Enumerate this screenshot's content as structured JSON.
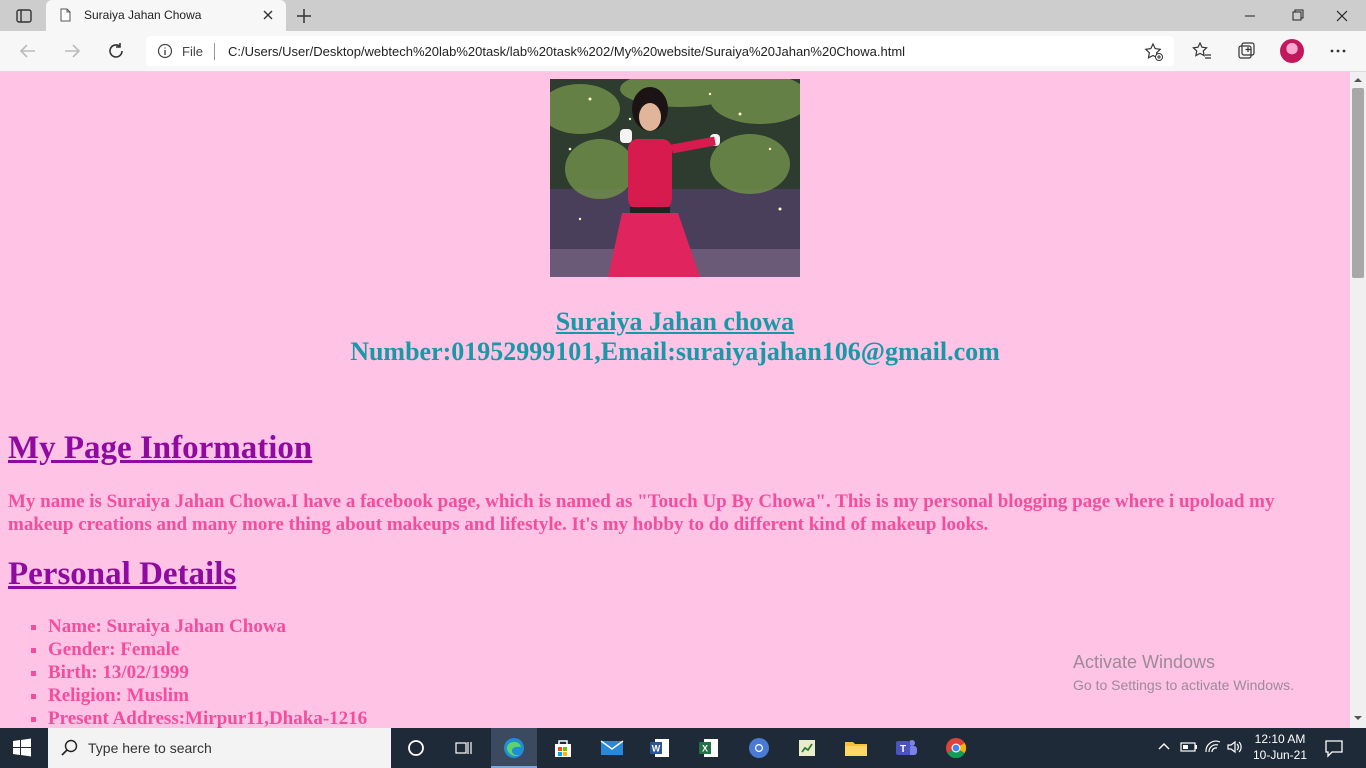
{
  "browser": {
    "tab_title": "Suraiya Jahan Chowa",
    "address_prefix": "File",
    "url": "C:/Users/User/Desktop/webtech%20lab%20task/lab%20task%202/My%20website/Suraiya%20Jahan%20Chowa.html"
  },
  "page": {
    "name_link": "Suraiya Jahan chowa",
    "contact": "Number:01952999101,Email:suraiyajahan106@gmail.com",
    "section1_title": "My Page Information",
    "section1_text": "My name is Suraiya Jahan Chowa.I have a facebook page, which is named as \"Touch Up By Chowa\". This is my personal blogging page where i upoload my makeup creations and many more thing about makeups and lifestyle. It's my hobby to do different kind of makeup looks.",
    "section2_title": "Personal Details",
    "details": [
      "Name: Suraiya Jahan Chowa",
      "Gender: Female",
      "Birth: 13/02/1999",
      "Religion: Muslim",
      "Present Address:Mirpur11,Dhaka-1216"
    ]
  },
  "watermark": {
    "title": "Activate Windows",
    "subtitle": "Go to Settings to activate Windows."
  },
  "taskbar": {
    "search_placeholder": "Type here to search",
    "time": "12:10 AM",
    "date": "10-Jun-21"
  },
  "colors": {
    "page_background": "#ffc3e6",
    "link_teal": "#179aa6",
    "heading_purple": "#8e0aa1",
    "text_pink": "#f24e9d"
  }
}
